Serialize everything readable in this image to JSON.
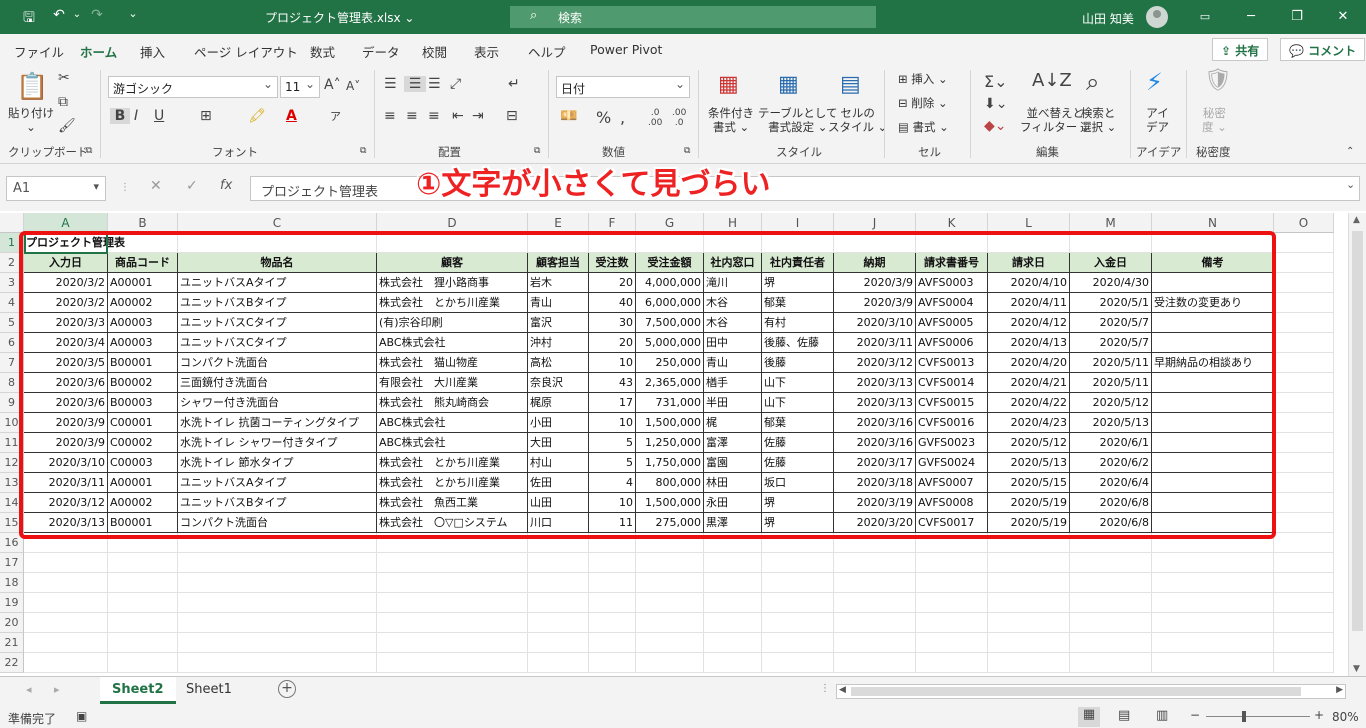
{
  "window": {
    "title": "プロジェクト管理表.xlsx",
    "search_placeholder": "検索",
    "user_name": "山田 知美"
  },
  "menu": {
    "tabs": [
      "ファイル",
      "ホーム",
      "挿入",
      "ページ レイアウト",
      "数式",
      "データ",
      "校閲",
      "表示",
      "ヘルプ",
      "Power Pivot"
    ],
    "active_tab": "ホーム",
    "share_label": "共有",
    "comment_label": "コメント"
  },
  "ribbon": {
    "paste_label": "貼り付け",
    "font_name": "游ゴシック",
    "font_size": "11",
    "number_format": "日付",
    "conditional_format": "条件付き\n書式",
    "format_as_table": "テーブルとして\n書式設定",
    "cell_styles": "セルの\nスタイル",
    "insert_label": "挿入",
    "delete_label": "削除",
    "format_label": "書式",
    "sort_filter": "並べ替えと\nフィルター",
    "find_select": "検索と\n選択",
    "ideas_label": "アイ\nデア",
    "sensitivity_label": "秘密\n度",
    "groups": [
      "クリップボード",
      "フォント",
      "配置",
      "数値",
      "スタイル",
      "セル",
      "編集",
      "アイデア",
      "秘密度"
    ]
  },
  "formula_bar": {
    "name_box": "A1",
    "fx": "fx",
    "content": "プロジェクト管理表"
  },
  "annotation": "①文字が小さくて見づらい",
  "grid": {
    "columns": [
      "A",
      "B",
      "C",
      "D",
      "E",
      "F",
      "G",
      "H",
      "I",
      "J",
      "K",
      "L",
      "M",
      "N",
      "O"
    ],
    "row_numbers": [
      "1",
      "2",
      "3",
      "4",
      "5",
      "6",
      "7",
      "8",
      "9",
      "10",
      "11",
      "12",
      "13",
      "14",
      "15",
      "16",
      "17",
      "18",
      "19",
      "20",
      "21",
      "22"
    ],
    "title_cell": "プロジェクト管理表",
    "headers": [
      "入力日",
      "商品コード",
      "物品名",
      "顧客",
      "顧客担当",
      "受注数",
      "受注金額",
      "社内窓口",
      "社内責任者",
      "納期",
      "請求書番号",
      "請求日",
      "入金日",
      "備考"
    ],
    "rows": [
      [
        "2020/3/2",
        "A00001",
        "ユニットバスAタイプ",
        "株式会社　狸小路商事",
        "岩木",
        "20",
        "4,000,000",
        "滝川",
        "堺",
        "2020/3/9",
        "AVFS0003",
        "2020/4/10",
        "2020/4/30",
        ""
      ],
      [
        "2020/3/2",
        "A00002",
        "ユニットバスBタイプ",
        "株式会社　とかち川産業",
        "青山",
        "40",
        "6,000,000",
        "木谷",
        "郁葉",
        "2020/3/9",
        "AVFS0004",
        "2020/4/11",
        "2020/5/1",
        "受注数の変更あり"
      ],
      [
        "2020/3/3",
        "A00003",
        "ユニットバスCタイプ",
        "(有)宗谷印刷",
        "富沢",
        "30",
        "7,500,000",
        "木谷",
        "有村",
        "2020/3/10",
        "AVFS0005",
        "2020/4/12",
        "2020/5/7",
        ""
      ],
      [
        "2020/3/4",
        "A00003",
        "ユニットバスCタイプ",
        "ABC株式会社",
        "沖村",
        "20",
        "5,000,000",
        "田中",
        "後藤、佐藤",
        "2020/3/11",
        "AVFS0006",
        "2020/4/13",
        "2020/5/7",
        ""
      ],
      [
        "2020/3/5",
        "B00001",
        "コンパクト洗面台",
        "株式会社　猫山物産",
        "高松",
        "10",
        "250,000",
        "青山",
        "後藤",
        "2020/3/12",
        "CVFS0013",
        "2020/4/20",
        "2020/5/11",
        "早期納品の相談あり"
      ],
      [
        "2020/3/6",
        "B00002",
        "三面鏡付き洗面台",
        "有限会社　大川産業",
        "奈良沢",
        "43",
        "2,365,000",
        "楢手",
        "山下",
        "2020/3/13",
        "CVFS0014",
        "2020/4/21",
        "2020/5/11",
        ""
      ],
      [
        "2020/3/6",
        "B00003",
        "シャワー付き洗面台",
        "株式会社　熊丸崎商会",
        "梶原",
        "17",
        "731,000",
        "半田",
        "山下",
        "2020/3/13",
        "CVFS0015",
        "2020/4/22",
        "2020/5/12",
        ""
      ],
      [
        "2020/3/9",
        "C00001",
        "水洗トイレ 抗菌コーティングタイプ",
        "ABC株式会社",
        "小田",
        "10",
        "1,500,000",
        "梶",
        "郁葉",
        "2020/3/16",
        "CVFS0016",
        "2020/4/23",
        "2020/5/13",
        ""
      ],
      [
        "2020/3/9",
        "C00002",
        "水洗トイレ シャワー付きタイプ",
        "ABC株式会社",
        "大田",
        "5",
        "1,250,000",
        "富澤",
        "佐藤",
        "2020/3/16",
        "GVFS0023",
        "2020/5/12",
        "2020/6/1",
        ""
      ],
      [
        "2020/3/10",
        "C00003",
        "水洗トイレ 節水タイプ",
        "株式会社　とかち川産業",
        "村山",
        "5",
        "1,750,000",
        "富園",
        "佐藤",
        "2020/3/17",
        "GVFS0024",
        "2020/5/13",
        "2020/6/2",
        ""
      ],
      [
        "2020/3/11",
        "A00001",
        "ユニットバスAタイプ",
        "株式会社　とかち川産業",
        "佐田",
        "4",
        "800,000",
        "林田",
        "坂口",
        "2020/3/18",
        "AVFS0007",
        "2020/5/15",
        "2020/6/4",
        ""
      ],
      [
        "2020/3/12",
        "A00002",
        "ユニットバスBタイプ",
        "株式会社　魚西工業",
        "山田",
        "10",
        "1,500,000",
        "永田",
        "堺",
        "2020/3/19",
        "AVFS0008",
        "2020/5/19",
        "2020/6/8",
        ""
      ],
      [
        "2020/3/13",
        "B00001",
        "コンパクト洗面台",
        "株式会社　〇▽□システム",
        "川口",
        "11",
        "275,000",
        "黒澤",
        "堺",
        "2020/3/20",
        "CVFS0017",
        "2020/5/19",
        "2020/6/8",
        ""
      ]
    ]
  },
  "sheets": {
    "tabs": [
      "Sheet2",
      "Sheet1"
    ],
    "active": "Sheet2"
  },
  "status": {
    "ready": "準備完了",
    "zoom": "80%"
  }
}
